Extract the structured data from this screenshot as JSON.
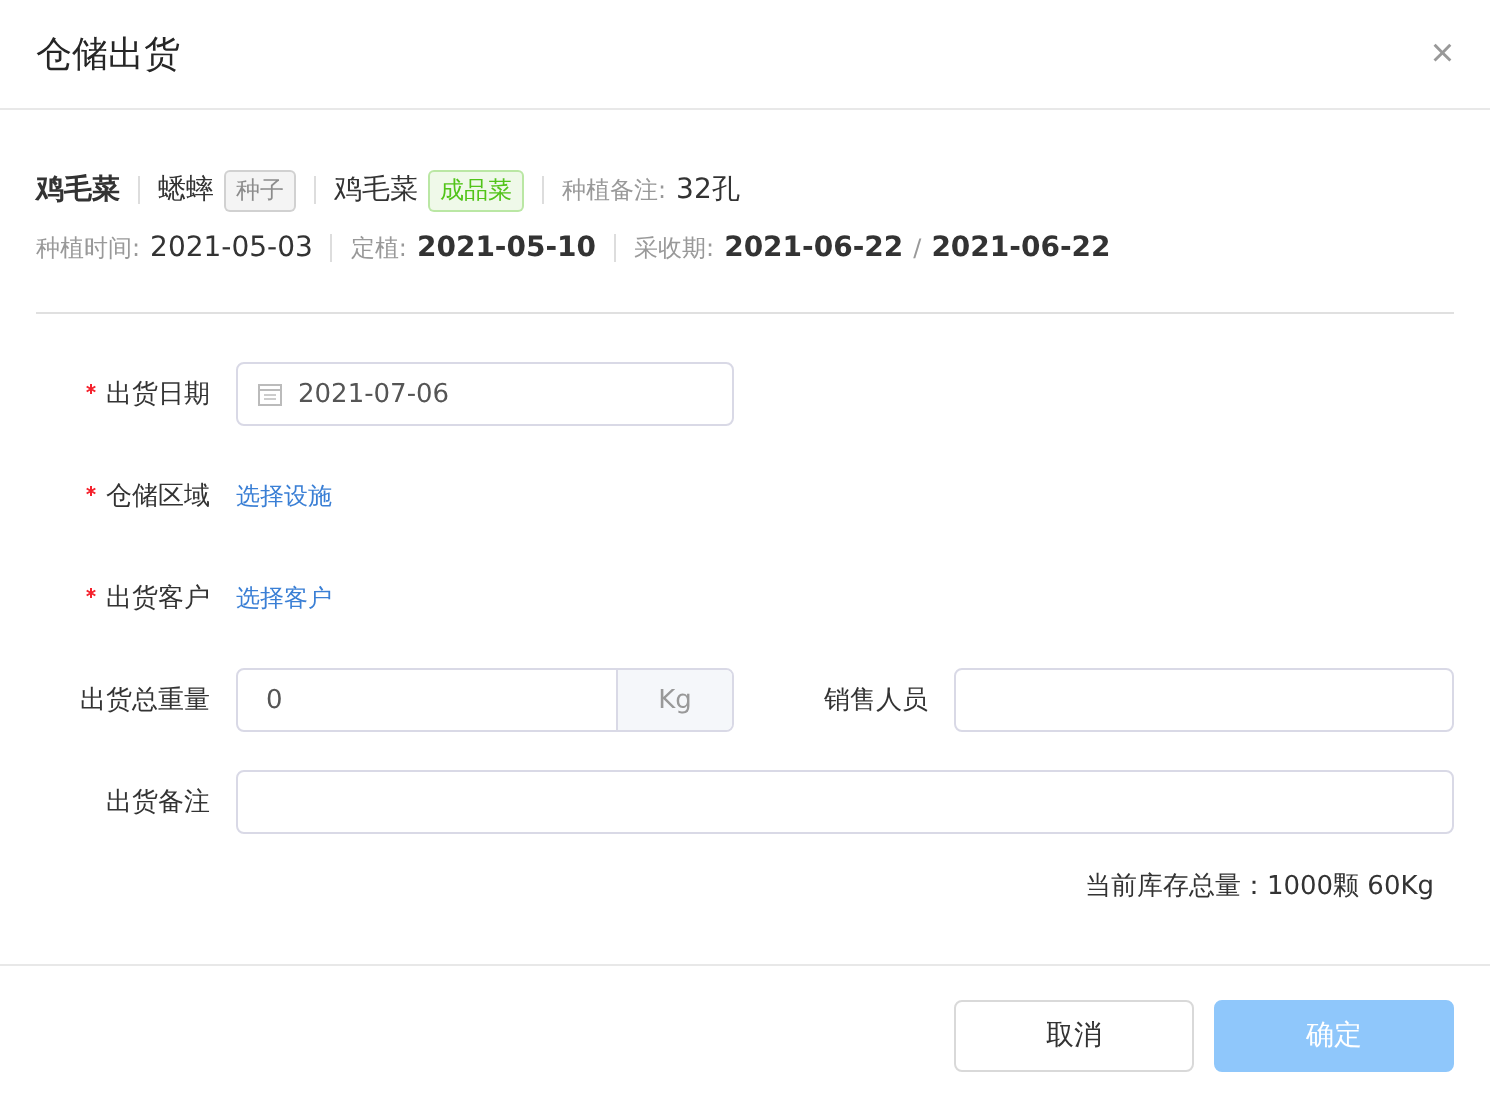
{
  "dialog": {
    "title": "仓储出货",
    "close": "×"
  },
  "summary_rows": [
    [
      [
        {
          "kind": "bold",
          "text": "鸡毛菜"
        }
      ],
      [
        {
          "kind": "value",
          "text": "蟋蟀"
        },
        {
          "kind": "tag",
          "text": "种子",
          "color": "#8c8c8c"
        }
      ],
      [
        {
          "kind": "value",
          "text": "鸡毛菜"
        },
        {
          "kind": "tag",
          "text": "成品菜",
          "color": "#52c41a"
        }
      ],
      [
        {
          "kind": "label",
          "text": "种植备注:"
        },
        {
          "kind": "value",
          "text": "32孔"
        }
      ]
    ],
    [
      [
        {
          "kind": "label",
          "text": "种植时间:"
        },
        {
          "kind": "value",
          "text": "2021-05-03"
        }
      ],
      [
        {
          "kind": "label",
          "text": "定植:"
        },
        {
          "kind": "bold",
          "text": "2021-05-10"
        }
      ],
      [
        {
          "kind": "label",
          "text": "采收期:"
        },
        {
          "kind": "bold",
          "text": "2021-06-22"
        },
        {
          "kind": "label",
          "text": "/"
        },
        {
          "kind": "bold",
          "text": "2021-06-22"
        }
      ]
    ]
  ],
  "form_rows": [
    [
      {
        "label": "出货日期",
        "required": true,
        "kind": "date",
        "value": "2021-07-06"
      }
    ],
    [
      {
        "label": "仓储区域",
        "required": true,
        "kind": "link",
        "value": "选择设施"
      }
    ],
    [
      {
        "label": "出货客户",
        "required": true,
        "kind": "link",
        "value": "选择客户"
      }
    ],
    [
      {
        "label": "出货总重量",
        "required": false,
        "kind": "unit",
        "value": "0",
        "unit": "Kg"
      },
      {
        "label": "销售人员",
        "required": false,
        "kind": "text"
      }
    ],
    [
      {
        "label": "出货备注",
        "required": false,
        "kind": "text"
      }
    ]
  ],
  "stock": "当前库存总量：1000颗 60Kg",
  "buttons": [
    {
      "label": "取消",
      "kind": "default",
      "disabled": false
    },
    {
      "label": "确定",
      "kind": "primary",
      "disabled": true
    }
  ]
}
